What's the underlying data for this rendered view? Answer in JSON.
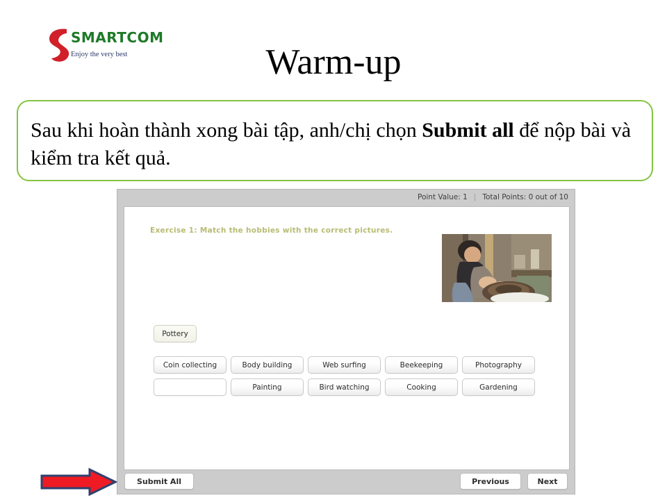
{
  "slide": {
    "title": "Warm-up",
    "brand": {
      "name": "SMARTCOM",
      "tagline": "Enjoy the very best",
      "name_color": "#1e7a28",
      "mark_color": "#d0202a",
      "tagline_color": "#2b3a6b"
    },
    "callout": {
      "text_before": "Sau khi hoàn thành xong bài tập, anh/chị chọn ",
      "text_bold": "Submit all",
      "text_after": " để nộp bài và kiểm tra kết quả.",
      "border_color": "#84c341"
    }
  },
  "quiz": {
    "status": {
      "point_value_label": "Point Value: 1",
      "separator": "|",
      "total_points_label": "Total Points: 0 out of 10"
    },
    "instruction": "Exercise 1: Match the hobbies with the correct pictures.",
    "instruction_color": "#b8bb72",
    "photo_alt": "person-making-pottery-on-wheel",
    "answer_tile": "Pottery",
    "tile_rows": [
      [
        "Coin collecting",
        "Body building",
        "Web surfing",
        "Beekeeping",
        "Photography"
      ],
      [
        "",
        "Painting",
        "Bird watching",
        "Cooking",
        "Gardening"
      ]
    ],
    "footer": {
      "submit_all_label": "Submit All",
      "previous_label": "Previous",
      "next_label": "Next"
    }
  },
  "annotation": {
    "arrow_fill": "#ee1b24",
    "arrow_stroke": "#2e4270"
  }
}
